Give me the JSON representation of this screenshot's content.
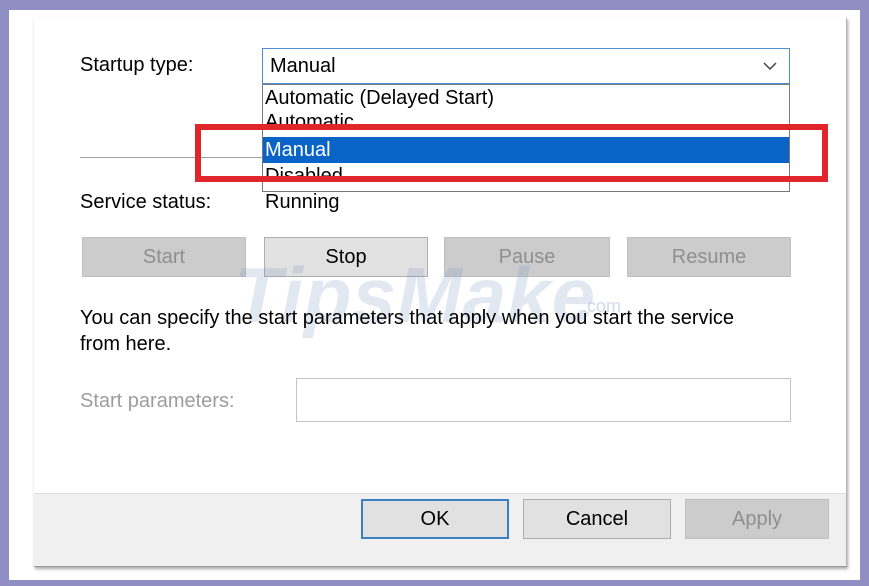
{
  "startup": {
    "label": "Startup type:",
    "value": "Manual",
    "options": [
      "Automatic (Delayed Start)",
      "Automatic",
      "Manual",
      "Disabled"
    ],
    "selected_index": 2
  },
  "service": {
    "status_label": "Service status:",
    "status_value": "Running"
  },
  "control_buttons": {
    "start": "Start",
    "stop": "Stop",
    "pause": "Pause",
    "resume": "Resume"
  },
  "description": {
    "line1": "You can specify the start parameters that apply when you start the service",
    "line2": "from here."
  },
  "params": {
    "label": "Start parameters:",
    "value": ""
  },
  "footer": {
    "ok": "OK",
    "cancel": "Cancel",
    "apply": "Apply"
  },
  "watermark": {
    "brand": "TipsMake",
    "suffix": ".com"
  },
  "colors": {
    "selection": "#0a64c8",
    "highlight_box": "#e0252b",
    "focus_border": "#3c7fc0",
    "outer_frame": "#8f8fc4"
  },
  "icons": {
    "dropdown_arrow": "chevron-down-icon"
  }
}
